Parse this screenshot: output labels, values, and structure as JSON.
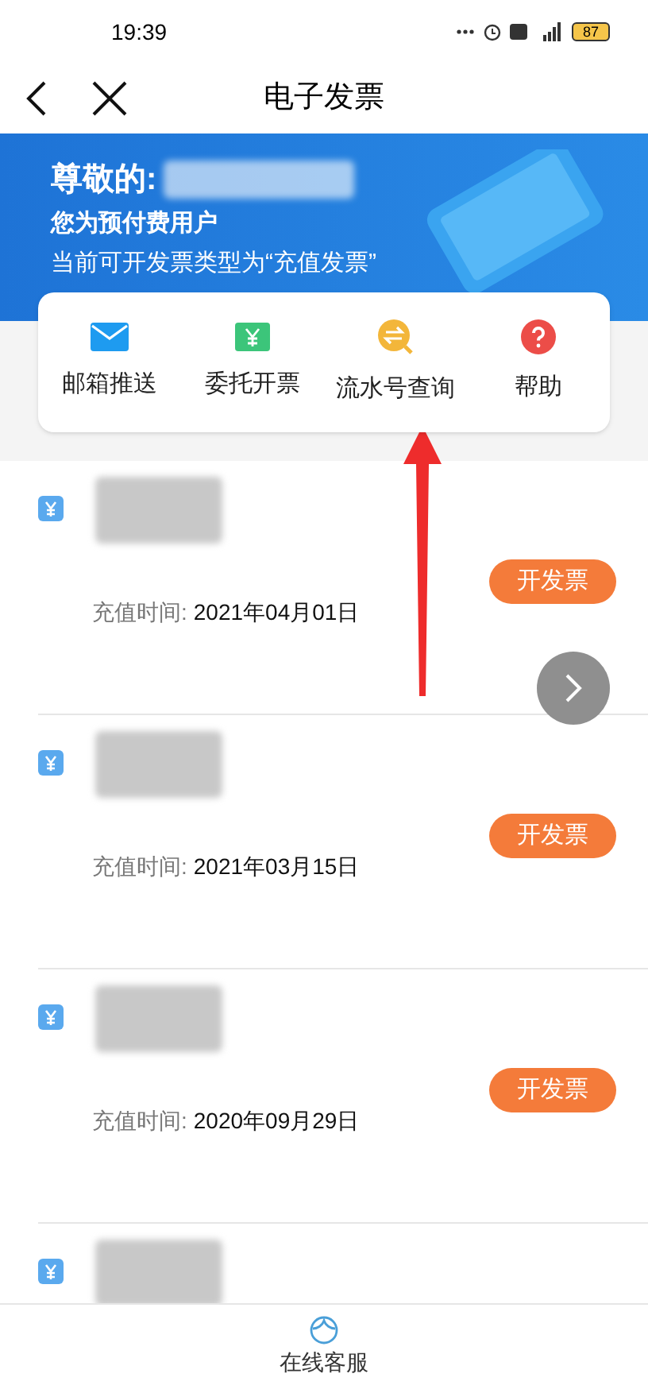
{
  "status_bar": {
    "time": "19:39",
    "battery": "87"
  },
  "nav": {
    "title": "电子发票"
  },
  "banner": {
    "greeting": "尊敬的:",
    "user_type": "您为预付费用户",
    "note": "当前可开发票类型为“充值发票”"
  },
  "actions": [
    {
      "kind": "mail",
      "label": "邮箱推送"
    },
    {
      "kind": "ticket",
      "label": "委托开票"
    },
    {
      "kind": "exchange",
      "label": "流水号查询"
    },
    {
      "kind": "help",
      "label": "帮助"
    }
  ],
  "records": [
    {
      "kind": "full",
      "time_label": "充值时间:",
      "date": "2021年04月01日",
      "button": "开发票"
    },
    {
      "kind": "full",
      "time_label": "充值时间:",
      "date": "2021年03月15日",
      "button": "开发票"
    },
    {
      "kind": "full",
      "time_label": "充值时间:",
      "date": "2020年09月29日",
      "button": "开发票"
    },
    {
      "kind": "partial"
    }
  ],
  "bottom_bar": {
    "label": "在线客服"
  }
}
